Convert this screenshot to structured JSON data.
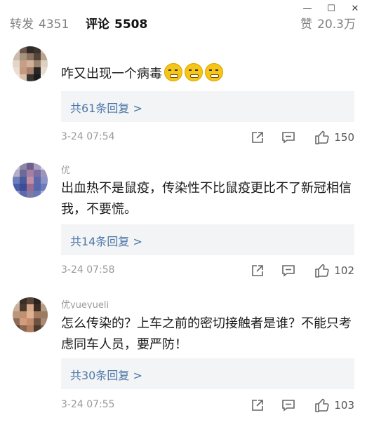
{
  "window_controls": {
    "minimize": "—",
    "maximize": "☐",
    "close": "✕"
  },
  "tabs": [
    {
      "label": "转发",
      "count": "4351",
      "active": false
    },
    {
      "label": "评论",
      "count": "5508",
      "active": true
    },
    {
      "label": "赞",
      "count": "20.3万",
      "active": false
    }
  ],
  "comments": [
    {
      "username": "",
      "text": "咋又出现一个病毒",
      "emoji": "sleepy-face-emoji",
      "emoji_count": 3,
      "reply_text": "共61条回复 >",
      "time": "3-24 07:54",
      "likes": "150"
    },
    {
      "username": "优",
      "text": "出血热不是鼠疫，传染性不比鼠疫更比不了新冠相信我，不要慌。",
      "reply_text": "共14条回复 >",
      "time": "3-24 07:58",
      "likes": "102"
    },
    {
      "username": "优yueyueli",
      "text": "怎么传染的？上车之前的密切接触者是谁？不能只考虑同车人员，要严防！",
      "reply_text": "共30条回复 >",
      "time": "3-24 07:55",
      "likes": "103"
    }
  ],
  "icons": {
    "share": "share-icon",
    "comment": "comment-icon",
    "like": "thumbs-up-icon"
  },
  "colors": {
    "link": "#4a76a8",
    "reply_bg": "#f3f4f6",
    "muted": "#9a9a9a"
  }
}
